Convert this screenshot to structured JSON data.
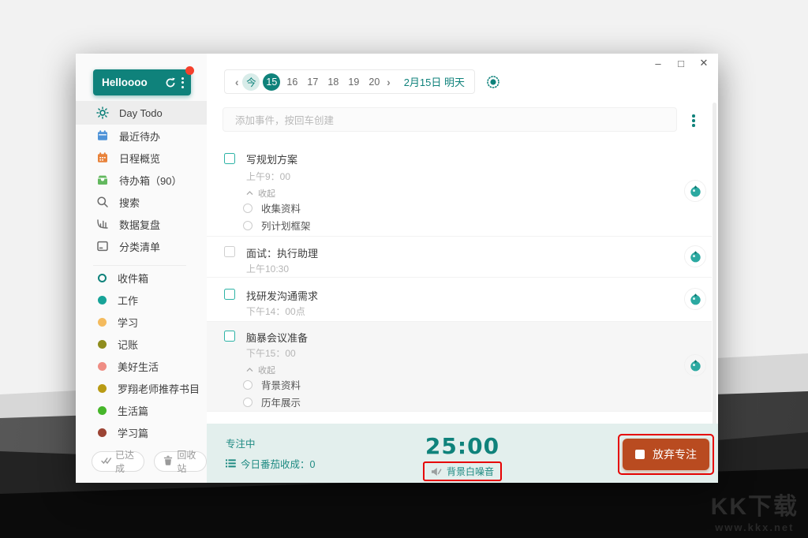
{
  "colors": {
    "teal": "#0f827b",
    "focus_bar_bg": "#e3efed",
    "abandon_btn": "#b94b20",
    "annotation_red": "#e60000",
    "badge_red": "#f5402c"
  },
  "window_controls": {
    "minimize": "–",
    "maximize": "□",
    "close": "✕"
  },
  "sidebar": {
    "profile": {
      "name": "Helloooo"
    },
    "nav": [
      {
        "label": "Day Todo"
      },
      {
        "label": "最近待办",
        "icon_color": "#4f93d8"
      },
      {
        "label": "日程概览",
        "icon_color": "#e8823a"
      },
      {
        "label": "待办箱（90）",
        "icon_color": "#63b85f"
      },
      {
        "label": "搜索"
      },
      {
        "label": "数据复盘"
      },
      {
        "label": "分类清单"
      }
    ],
    "lists": [
      {
        "label": "收件箱",
        "color": "#0f827b"
      },
      {
        "label": "工作",
        "color": "#17a398"
      },
      {
        "label": "学习",
        "color": "#f4bb5e"
      },
      {
        "label": "记账",
        "color": "#8f8d1e"
      },
      {
        "label": "美好生活",
        "color": "#ef8d84"
      },
      {
        "label": "罗翔老师推荐书目",
        "color": "#b99b15"
      },
      {
        "label": "生活篇",
        "color": "#46b62a"
      },
      {
        "label": "学习篇",
        "color": "#9c4434"
      }
    ],
    "footer": {
      "done": "已达成",
      "recycle": "回收站"
    }
  },
  "datebar": {
    "prev": "‹",
    "next": "›",
    "days": [
      "今",
      "15",
      "16",
      "17",
      "18",
      "19",
      "20"
    ],
    "date_label": "2月15日 明天"
  },
  "composer": {
    "placeholder": "添加事件，按回车创建"
  },
  "todos": [
    {
      "title": "写规划方案",
      "time": "上午9：00",
      "collapse": "收起",
      "subtasks": [
        "收集资料",
        "列计划框架"
      ]
    },
    {
      "title": "面试：执行助理",
      "time": "上午10:30"
    },
    {
      "title": "找研发沟通需求",
      "time": "下午14：00点"
    },
    {
      "title": "脑暴会议准备",
      "time": "下午15：00",
      "collapse": "收起",
      "subtasks": [
        "背景资料",
        "历年展示"
      ]
    }
  ],
  "focus": {
    "status": "专注中",
    "harvest": "今日番茄收成：0",
    "timer": "25:00",
    "noise": "背景白噪音",
    "abandon": "放弃专注"
  },
  "watermark": {
    "logo": "KK下载",
    "url": "www.kkx.net"
  }
}
